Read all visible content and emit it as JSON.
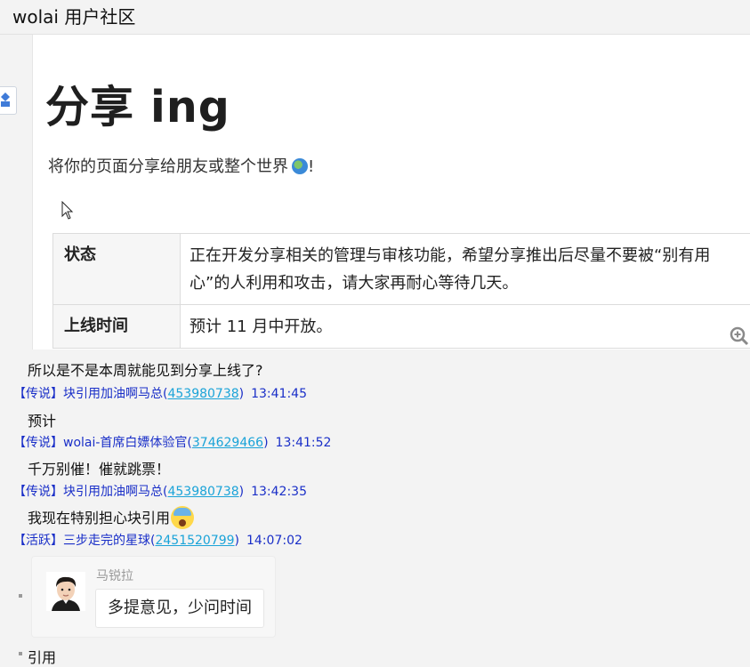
{
  "window": {
    "title": "wolai 用户社区"
  },
  "card": {
    "heading": "分享 ing",
    "subtitle": "将你的页面分享给朋友或整个世界",
    "subtitle_tail": "!",
    "table": [
      {
        "key": "状态",
        "value": "正在开发分享相关的管理与审核功能，希望分享推出后尽量不要被“别有用心”的人利用和攻击，请大家再耐心等待几天。"
      },
      {
        "key": "上线时间",
        "value": "预计 11 月中开放。"
      }
    ]
  },
  "messages": [
    {
      "text": "所以是不是本周就能见到分享上线了?"
    },
    {
      "meta": {
        "prefix": "【传说】块引用加油啊马总(",
        "qq": "453980738",
        "suffix": ")",
        "time": "13:41:45"
      }
    },
    {
      "text": "预计"
    },
    {
      "meta": {
        "prefix": "【传说】wolai-首席白嫖体验官(",
        "qq": "374629466",
        "suffix": ")",
        "time": "13:41:52"
      }
    },
    {
      "text": "千万别催！催就跳票！"
    },
    {
      "meta": {
        "prefix": "【传说】块引用加油啊马总(",
        "qq": "453980738",
        "suffix": ")",
        "time": "13:42:35"
      }
    },
    {
      "text": "我现在特别担心块引用"
    },
    {
      "meta": {
        "prefix": "【活跃】三步走完的星球(",
        "qq": "2451520799",
        "suffix": ")",
        "time": "14:07:02"
      }
    }
  ],
  "quote": {
    "name": "马锐拉",
    "text": "多提意见，少问时间"
  },
  "footer_text": "引用",
  "icons": {
    "globe": "globe-icon",
    "emoji": "screaming-face-emoji",
    "zoom": "zoom-in-icon",
    "avatar": "avatar"
  },
  "colors": {
    "meta_blue": "#1a2fc8",
    "qq_link": "#1aa3d8"
  }
}
